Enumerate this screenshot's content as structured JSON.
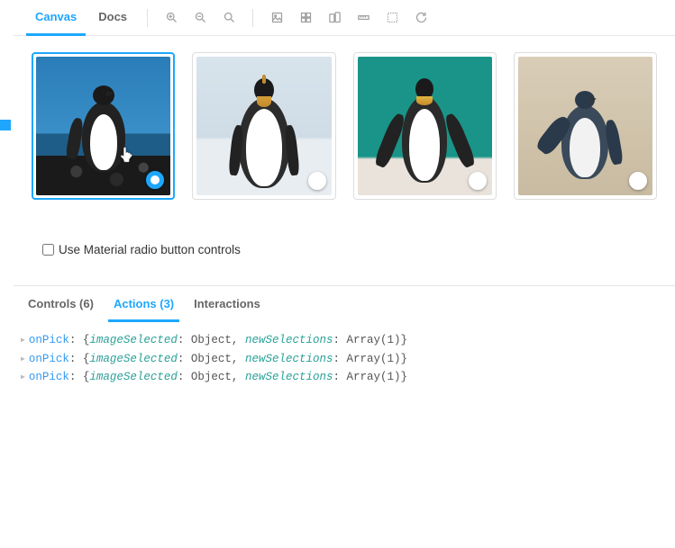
{
  "topTabs": {
    "canvas": "Canvas",
    "docs": "Docs"
  },
  "checkbox": {
    "label": "Use Material radio button controls"
  },
  "bottomTabs": {
    "controls": "Controls (6)",
    "actions": "Actions (3)",
    "interactions": "Interactions"
  },
  "logs": [
    {
      "event": "onPick",
      "k1": "imageSelected",
      "v1": "Object",
      "k2": "newSelections",
      "v2": "Array(1)"
    },
    {
      "event": "onPick",
      "k1": "imageSelected",
      "v1": "Object",
      "k2": "newSelections",
      "v2": "Array(1)"
    },
    {
      "event": "onPick",
      "k1": "imageSelected",
      "v1": "Object",
      "k2": "newSelections",
      "v2": "Array(1)"
    }
  ],
  "images": {
    "count": 4,
    "selectedIndex": 0
  }
}
